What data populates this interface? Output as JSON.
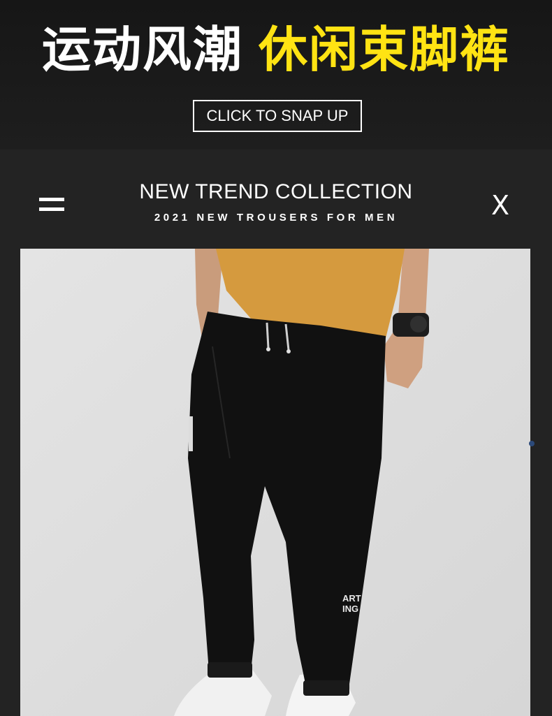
{
  "banner": {
    "headline_white": "运动风潮",
    "headline_yellow": "休闲束脚裤",
    "cta_label": "CLICK TO SNAP UP"
  },
  "section": {
    "title": "NEW TREND COLLECTION",
    "subtitle": "2021 NEW TROUSERS FOR MEN",
    "close_label": "X"
  },
  "product_photo": {
    "print_line1": "ART",
    "print_line2": "ING"
  },
  "colors": {
    "accent_yellow": "#ffe313",
    "background": "#232323",
    "shirt": "#d59a3e",
    "trousers": "#111111"
  }
}
